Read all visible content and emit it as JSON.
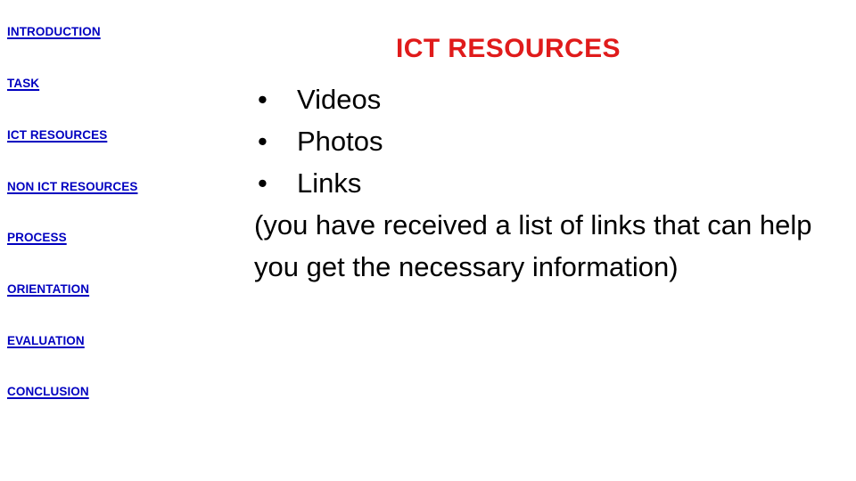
{
  "slide": {
    "background_color": "#ffffff",
    "title": "ICT RESOURCES",
    "title_color": "#e01b1b"
  },
  "sidebar": {
    "link_color": "#0000c0",
    "items": [
      {
        "label": "INTRODUCTION"
      },
      {
        "label": "TASK"
      },
      {
        "label": "ICT RESOURCES"
      },
      {
        "label": "NON ICT RESOURCES"
      },
      {
        "label": "PROCESS"
      },
      {
        "label": "ORIENTATION"
      },
      {
        "label": "EVALUATION"
      },
      {
        "label": "CONCLUSION"
      }
    ]
  },
  "main": {
    "bullet_glyph": "•",
    "bullets": [
      {
        "label": "Videos"
      },
      {
        "label": "Photos"
      },
      {
        "label": "Links"
      }
    ],
    "paragraph": "(you have received a list of links that can help you get the necessary information)",
    "text_color": "#000000"
  }
}
